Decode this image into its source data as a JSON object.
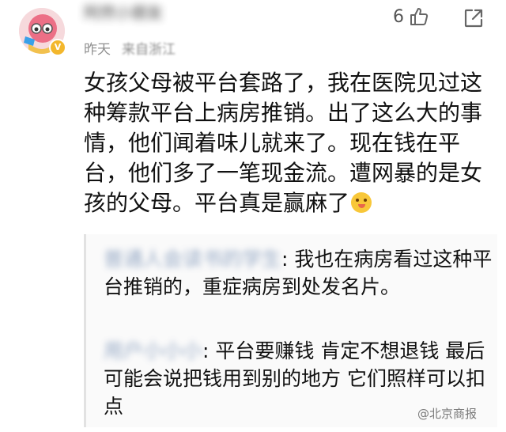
{
  "comment": {
    "username": "阿然小朋友",
    "meta": {
      "time": "昨天",
      "location": "来自浙江"
    },
    "likes": "6",
    "text": "女孩父母被平台套路了，我在医院见过这种筹款平台上病房推销。出了这么大的事情，他们闻着味儿就来了。现在钱在平台，他们多了一笔现金流。遭网暴的是女孩的父母。平台真是赢麻了",
    "emoji_icon": "face-emoji-icon",
    "like_icon": "thumbs-up-icon",
    "share_icon": "share-icon",
    "verified_badge": "V"
  },
  "replies": [
    {
      "name": "普通人会读书的学生",
      "text": ": 我也在病房看过这种平台推销的，重症病房到处发名片。"
    },
    {
      "name": "用户小小小",
      "text": ": 平台要赚钱 肯定不想退钱 最后可能会说把钱用到别的地方 它们照样可以扣点"
    }
  ],
  "watermark": "@北京商报",
  "colors": {
    "meta": "#8f8f8f",
    "reply_border": "#e2e2e2",
    "badge": "#f3b72c"
  }
}
